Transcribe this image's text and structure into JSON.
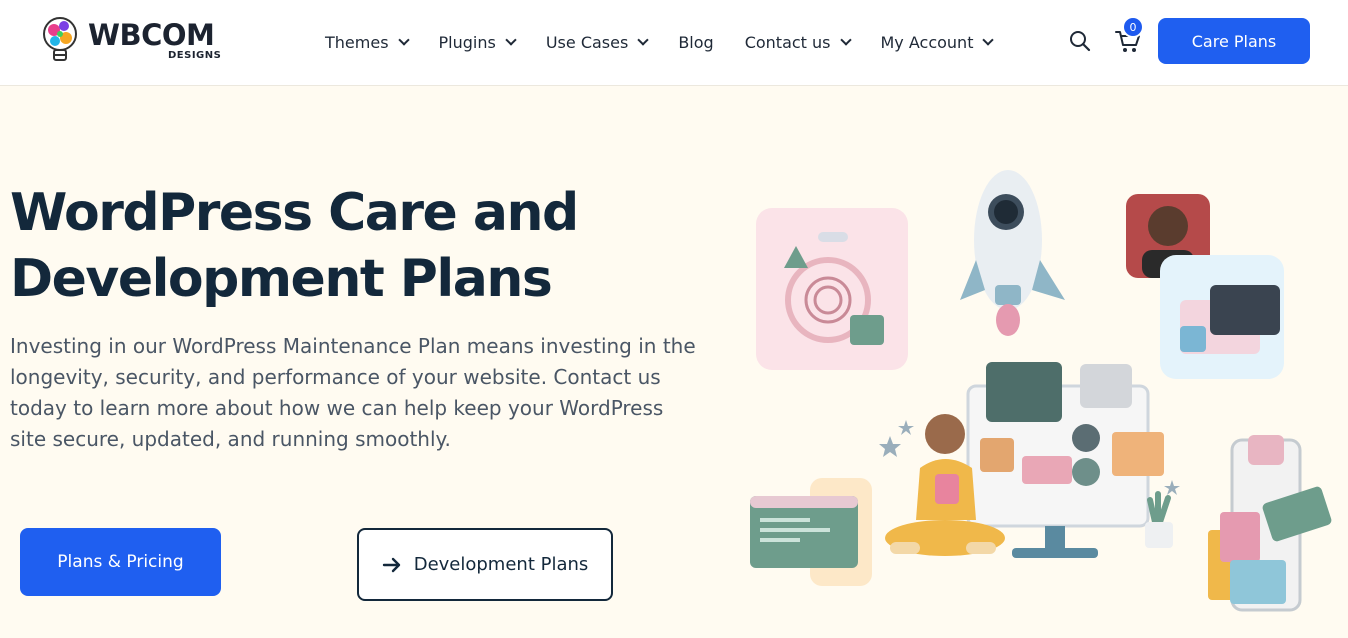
{
  "header": {
    "logo_word": "WBCOM",
    "logo_sub": "DESIGNS",
    "nav": [
      {
        "label": "Themes",
        "has_dropdown": true
      },
      {
        "label": "Plugins",
        "has_dropdown": true
      },
      {
        "label": "Use Cases",
        "has_dropdown": true
      },
      {
        "label": "Blog",
        "has_dropdown": false
      },
      {
        "label": "Contact us",
        "has_dropdown": true
      },
      {
        "label": "My Account",
        "has_dropdown": true
      }
    ],
    "search_icon": "search-icon",
    "cart_icon": "cart-icon",
    "cart_count": "0",
    "cta_label": "Care Plans"
  },
  "hero": {
    "title": "WordPress Care and Development Plans",
    "description": "Investing in our WordPress Maintenance Plan means investing in the longevity, security, and performance of your website. Contact us today to learn more about how we can help keep your WordPress site secure, updated, and running smoothly.",
    "primary_button": "Plans & Pricing",
    "secondary_button": "Development Plans",
    "secondary_icon": "arrow-right-icon"
  },
  "colors": {
    "accent": "#1f5ff0",
    "heading": "#13283b",
    "background": "#fffbf1"
  }
}
